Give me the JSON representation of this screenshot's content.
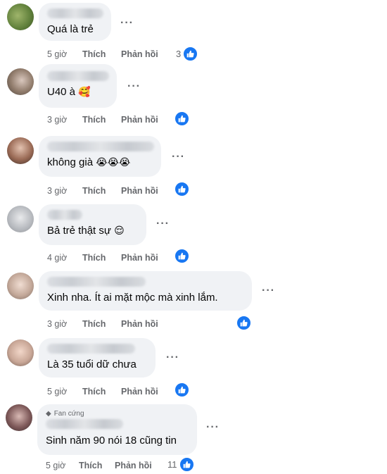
{
  "comments": [
    {
      "text": "Quá là trẻ",
      "emoji": "",
      "time": "5 giờ",
      "like": "Thích",
      "reply": "Phản hồi",
      "count": "3",
      "avatar_color": "#5f7f3a"
    },
    {
      "text": "U40 à",
      "emoji": "🥰",
      "time": "3 giờ",
      "like": "Thích",
      "reply": "Phản hồi",
      "count": "",
      "avatar_color": "#8f7a6a"
    },
    {
      "text": "không già",
      "emoji": "😭😭😭",
      "time": "3 giờ",
      "like": "Thích",
      "reply": "Phản hồi",
      "count": "",
      "avatar_color": "#9a6a55"
    },
    {
      "text": "Bả trẻ thật sự",
      "emoji": "😌",
      "time": "4 giờ",
      "like": "Thích",
      "reply": "Phản hồi",
      "count": "",
      "avatar_color": "#b5b8bd"
    },
    {
      "text": "Xinh nha. Ít ai mặt mộc mà xinh lắm.",
      "emoji": "",
      "time": "3 giờ",
      "like": "Thích",
      "reply": "Phản hồi",
      "count": "",
      "avatar_color": "#c4a99a"
    },
    {
      "text": "Là 35 tuổi dữ chưa",
      "emoji": "",
      "time": "5 giờ",
      "like": "Thích",
      "reply": "Phản hồi",
      "count": "",
      "avatar_color": "#c9a797"
    },
    {
      "text": "Sinh năm 90 nói 18 cũng tin",
      "emoji": "",
      "badge": "Fan cứng",
      "time": "5 giờ",
      "like": "Thích",
      "reply": "Phản hồi",
      "count": "11",
      "avatar_color": "#7f5a5a"
    }
  ],
  "icons": {
    "more": "more-options-icon",
    "like_reaction": "like-thumb-icon",
    "badge": "diamond-icon"
  },
  "colors": {
    "accent": "#1877f2",
    "bubble": "#f0f2f5",
    "meta": "#65676b"
  }
}
